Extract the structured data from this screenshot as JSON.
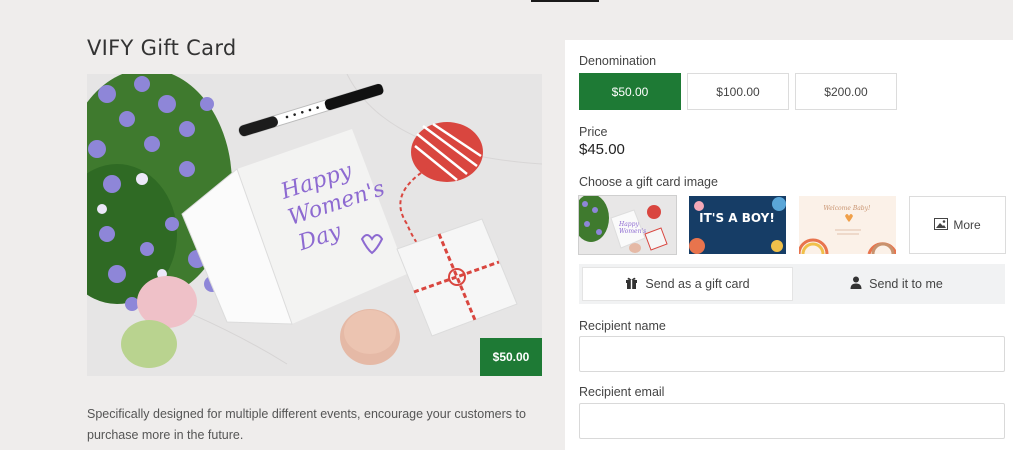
{
  "product": {
    "title": "VIFY Gift Card",
    "price_badge": "$50.00",
    "description": "Specifically designed for multiple different events, encourage your customers to purchase more in the future.",
    "hero_card_text": [
      "Happy",
      "Women's",
      "Day"
    ]
  },
  "form": {
    "denomination_label": "Denomination",
    "denominations": [
      {
        "label": "$50.00",
        "selected": true
      },
      {
        "label": "$100.00",
        "selected": false
      },
      {
        "label": "$200.00",
        "selected": false
      }
    ],
    "price_label": "Price",
    "price_value": "$45.00",
    "image_label": "Choose a gift card image",
    "thumbnails": [
      {
        "name": "womens-day",
        "selected": true
      },
      {
        "name": "its-a-boy",
        "text": "IT'S A BOY!"
      },
      {
        "name": "welcome-baby",
        "text": "Welcome Baby!"
      }
    ],
    "more_label": "More",
    "send_tabs": [
      {
        "label": "Send as a gift card",
        "icon": "gift-icon",
        "active": true
      },
      {
        "label": "Send it to me",
        "icon": "person-icon",
        "active": false
      }
    ],
    "recipient_name_label": "Recipient name",
    "recipient_name_value": "",
    "recipient_email_label": "Recipient email",
    "recipient_email_value": ""
  },
  "colors": {
    "accent": "#1e7a35",
    "page_bg": "#efedec",
    "panel_bg": "#ffffff"
  }
}
